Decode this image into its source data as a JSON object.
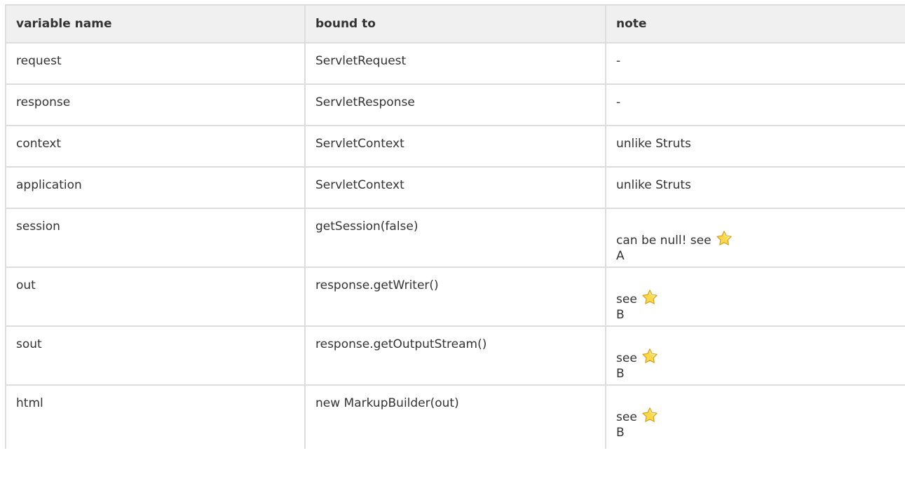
{
  "table": {
    "headers": [
      "variable name",
      "bound to",
      "note"
    ],
    "rows": [
      {
        "variable": "request",
        "bound": "ServletRequest",
        "note": "-",
        "ref": ""
      },
      {
        "variable": "response",
        "bound": "ServletResponse",
        "note": "-",
        "ref": ""
      },
      {
        "variable": "context",
        "bound": "ServletContext",
        "note": "unlike Struts",
        "ref": ""
      },
      {
        "variable": "application",
        "bound": "ServletContext",
        "note": "unlike Struts",
        "ref": ""
      },
      {
        "variable": "session",
        "bound": "getSession(false)",
        "note": "can be null! see",
        "ref": "A"
      },
      {
        "variable": "out",
        "bound": "response.getWriter()",
        "note": "see",
        "ref": "B"
      },
      {
        "variable": "sout",
        "bound": "response.getOutputStream()",
        "note": "see",
        "ref": "B"
      },
      {
        "variable": "html",
        "bound": "new MarkupBuilder(out)",
        "note": "see",
        "ref": "B"
      }
    ]
  },
  "icons": {
    "star": "star-icon"
  }
}
